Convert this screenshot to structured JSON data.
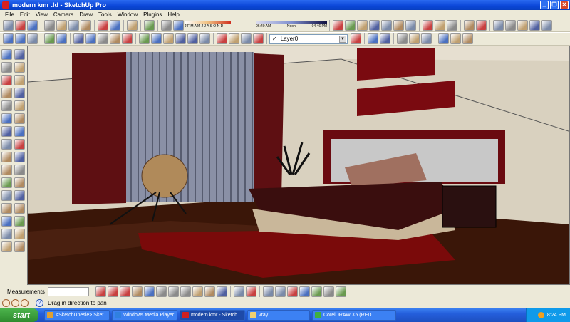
{
  "window": {
    "title": "modern kmr .ld - SketchUp Pro",
    "min": "_",
    "max": "❐",
    "close": "✕"
  },
  "menu": [
    "File",
    "Edit",
    "View",
    "Camera",
    "Draw",
    "Tools",
    "Window",
    "Plugins",
    "Help"
  ],
  "shadow": {
    "months": "J F M A M J J A S O N D",
    "time_start": "06:40 AM",
    "noon": "Noon",
    "time_end": "04:46 PM"
  },
  "layer": {
    "checked": "✓",
    "name": "Layer0"
  },
  "toolbar1_icons": [
    "new-icon",
    "open-icon",
    "save-icon",
    "sep",
    "cut-icon",
    "copy-icon",
    "paste-icon",
    "erase-icon",
    "sep",
    "undo-icon",
    "redo-icon",
    "sep",
    "print-icon",
    "sep",
    "model-info-icon",
    "sep",
    "shadow-settings-icon",
    "shadow-toggle-icon"
  ],
  "toolbar1_right_icons": [
    "sep",
    "orbit-plugin-icon",
    "plugin-icon",
    "plugin-icon",
    "plugin-icon",
    "plugin-icon",
    "plugin-icon",
    "plugin-close-icon",
    "sep",
    "move-icon",
    "section-icon",
    "section-fill-icon",
    "sep",
    "texture-icon",
    "texture-icon",
    "sep",
    "texture-red-icon",
    "texture-sphere-icon",
    "texture-icon",
    "texture-icon",
    "texture-icon"
  ],
  "toolbar2_icons": [
    "select-icon",
    "paint-icon",
    "component-icon",
    "sep",
    "xray-icon",
    "wireframe-icon",
    "sep",
    "hidden-line-icon",
    "shaded-icon",
    "shaded-texture-icon",
    "monochrome-icon",
    "back-edges-icon",
    "sep",
    "iso-icon",
    "top-view-icon",
    "front-view-icon",
    "right-view-icon",
    "back-view-icon",
    "left-view-icon",
    "sep",
    "warehouse-icon",
    "door-icon",
    "house-icon",
    "window-icon"
  ],
  "toolbar2_right_icons": [
    "layer-manager-icon",
    "sep",
    "add-location-icon",
    "terrain-icon",
    "sep",
    "get-models-icon",
    "share-model-icon",
    "google-earth-icon",
    "sep",
    "get-component-icon",
    "share-component-icon",
    "component-outline-icon"
  ],
  "palette_icons": [
    "select-icon",
    "component-icon",
    "paint-icon",
    "eraser-icon",
    "rectangle-icon",
    "line-icon",
    "circle-icon",
    "arc-icon",
    "polygon-icon",
    "freehand-icon",
    "move-icon",
    "push-pull-icon",
    "rotate-icon",
    "follow-me-icon",
    "scale-icon",
    "offset-icon",
    "tape-measure-icon",
    "dimension-icon",
    "protractor-icon",
    "text-icon",
    "axes-icon",
    "3d-text-icon",
    "orbit-icon",
    "pan-icon",
    "zoom-icon",
    "zoom-window-icon",
    "zoom-extents-icon",
    "previous-view-icon",
    "position-camera-icon",
    "walk-icon",
    "look-around-icon",
    "section-plane-icon"
  ],
  "measurements": {
    "label": "Measurements",
    "value": ""
  },
  "bottom_icons": [
    "vray-material-icon",
    "vray-options-icon",
    "vray-render-icon",
    "vray-help-icon",
    "vray-frame-icon",
    "vray-light-icon",
    "vray-spot-icon",
    "vray-ies-icon",
    "vray-omni-icon",
    "vray-sphere-icon",
    "vray-sun-icon",
    "sep",
    "vray-rt-icon",
    "vray-cam-icon",
    "sep",
    "plugin-green-icon",
    "plugin-star-icon",
    "plugin-arrow-icon",
    "plugin-chart-icon",
    "plugin-pencil-icon",
    "plugin-gear-icon",
    "plugin-frog-icon"
  ],
  "status": {
    "hint": "Drag in direction to pan",
    "help": "?"
  },
  "taskbar": {
    "start": "start",
    "tasks": [
      "<SketchUnesie> Sket...",
      "Windows Media Player",
      "modern kmr - Sketch...",
      "vray",
      "CorelDRAW X5 (REDT..."
    ],
    "clock": "8:24 PM"
  }
}
